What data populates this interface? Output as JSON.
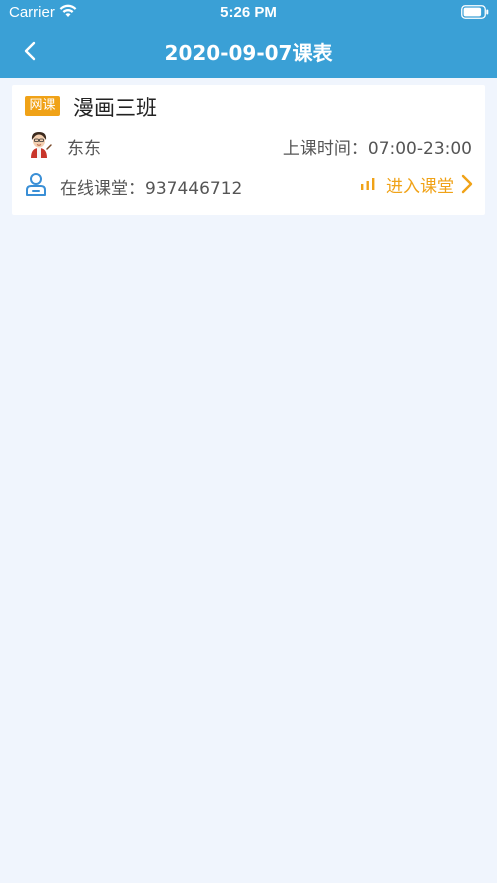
{
  "status_bar": {
    "carrier": "Carrier",
    "time": "5:26 PM"
  },
  "nav": {
    "title": "2020-09-07课表",
    "back_icon": "chevron-left-icon"
  },
  "course": {
    "tag": "网课",
    "name": "漫画三班",
    "teacher": "东东",
    "time": "上课时间：07:00-23:00",
    "room": "在线课堂：937446712",
    "enter_label": "进入课堂"
  },
  "colors": {
    "header": "#3aa0d6",
    "background": "#f0f5fd",
    "accent": "#f0a217",
    "icon_blue": "#3a8fd6"
  }
}
